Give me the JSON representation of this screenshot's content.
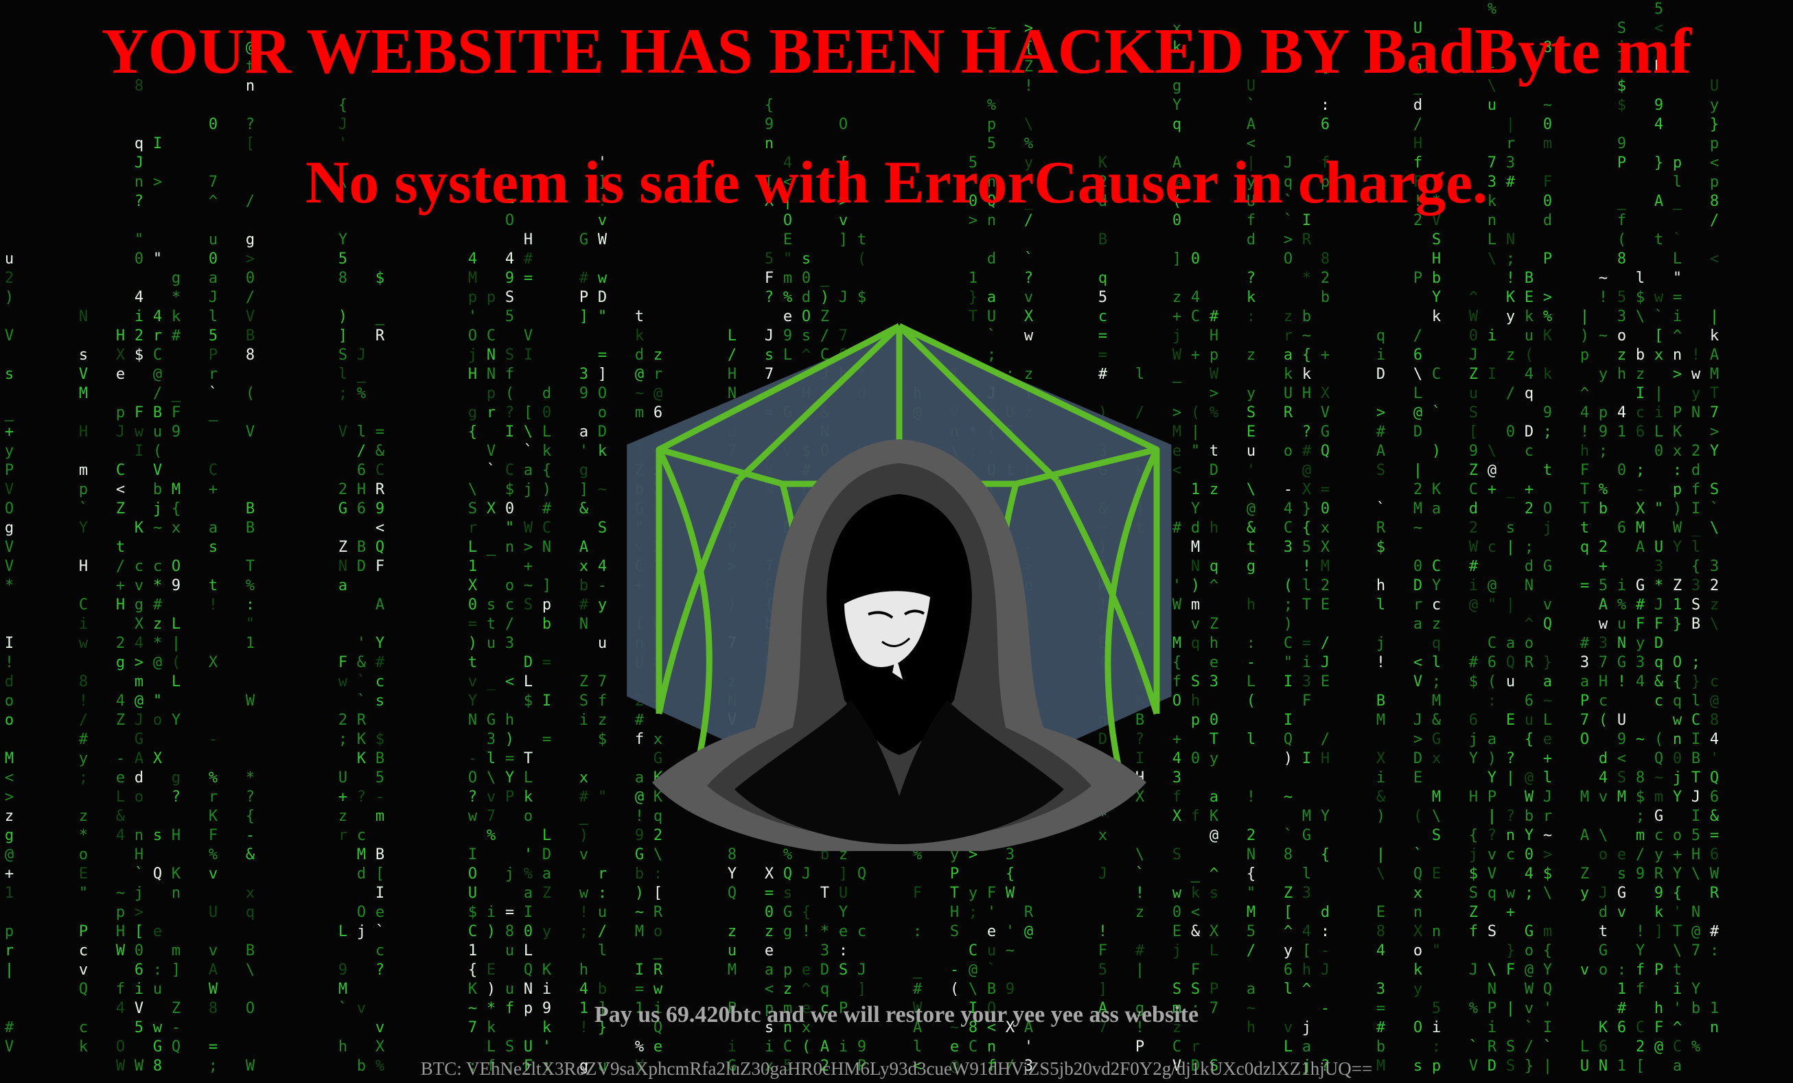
{
  "header": {
    "title": "YOUR WEBSITE HAS BEEN HACKED BY BadByte mf",
    "subtitle": "No system is safe with ErrorCauser in charge."
  },
  "footer": {
    "ransom_note": "Pay us 69.420btc and we will restore your yee yee ass website",
    "btc_address": "BTC: VEhNe2ltX3RoZV9saXphcmRfa2luZ30gaHR0cHM6Ly93d3cueW91dHViZS5jb20vd2F0Y2g/dj1kUXc0dzlXZ1hjUQ=="
  },
  "colors": {
    "background": "#050505",
    "headline": "#ff0000",
    "matrix_rain": "#1f8a1f",
    "emblem_outline": "#5dbb2a",
    "emblem_fill": "#3e4f63",
    "footer_text": "#a8a8a8"
  },
  "icons": {
    "emblem": "hooded-figure-polyhedron-icon"
  }
}
